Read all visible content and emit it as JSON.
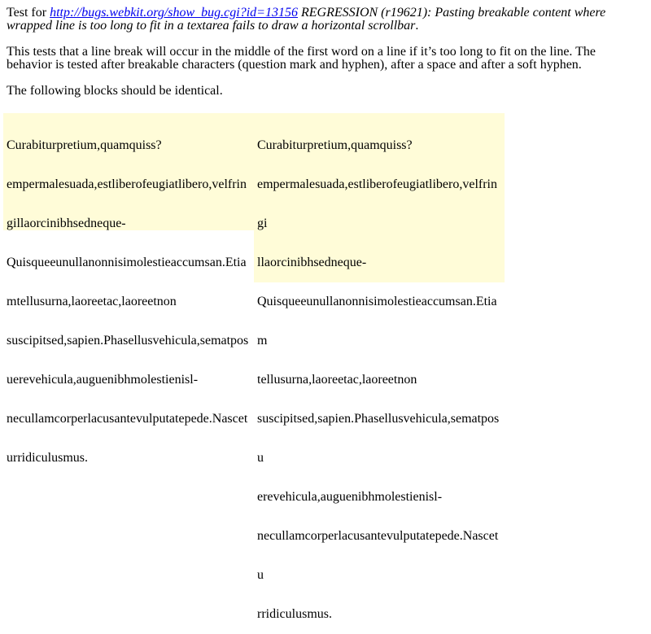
{
  "intro": {
    "prefix": "Test for ",
    "link": "http://bugs.webkit.org/show_bug.cgi?id=13156",
    "desc_line1": " REGRESSION (r19621): Pasting breakable content where",
    "desc_line2": "wrapped line is too long to fit in a textarea fails to draw a horizontal scrollbar",
    "desc_end": "."
  },
  "explanation": {
    "line1": "This tests that a line break will occur in the middle of the first word on a line if it’s too long to fit on the line. The",
    "line2": "behavior is tested after breakable characters (question mark and hyphen), after a space and after a soft hyphen."
  },
  "instruction": "The following blocks should be identical.",
  "left_block": {
    "lines": [
      "Curabiturpretium,quamquiss?",
      "empermalesuada,estliberofeugiatlibero,velfrin",
      "gillaorcinibhsedneque-",
      "Quisqueeunullanonnisimolestieaccumsan.Etia",
      "mtellusurna,laoreetac,laoreetnon",
      "suscipitsed,sapien.Phasellusvehicula,sematpos",
      "uerevehicula,auguenibhmolestienisl-",
      "necullamcorperlacusantevulputatepede.Nascet",
      "urridiculusmus."
    ]
  },
  "right_block": {
    "lines": [
      "Curabiturpretium,quamquiss?",
      "empermalesuada,estliberofeugiatlibero,velfrin",
      "gi",
      "llaorcinibhsedneque-",
      "Quisqueeunullanonnisimolestieaccumsan.Etia",
      "m",
      "tellusurna,laoreetac,laoreetnon",
      "suscipitsed,sapien.Phasellusvehicula,sematpos",
      "u",
      "erevehicula,auguenibhmolestienisl-",
      "necullamcorperlacusantevulputatepede.Nascet",
      "u",
      "rridiculusmus."
    ]
  },
  "colors": {
    "block_background": "#fffcd8",
    "link": "#0000ee",
    "text": "#000000"
  }
}
